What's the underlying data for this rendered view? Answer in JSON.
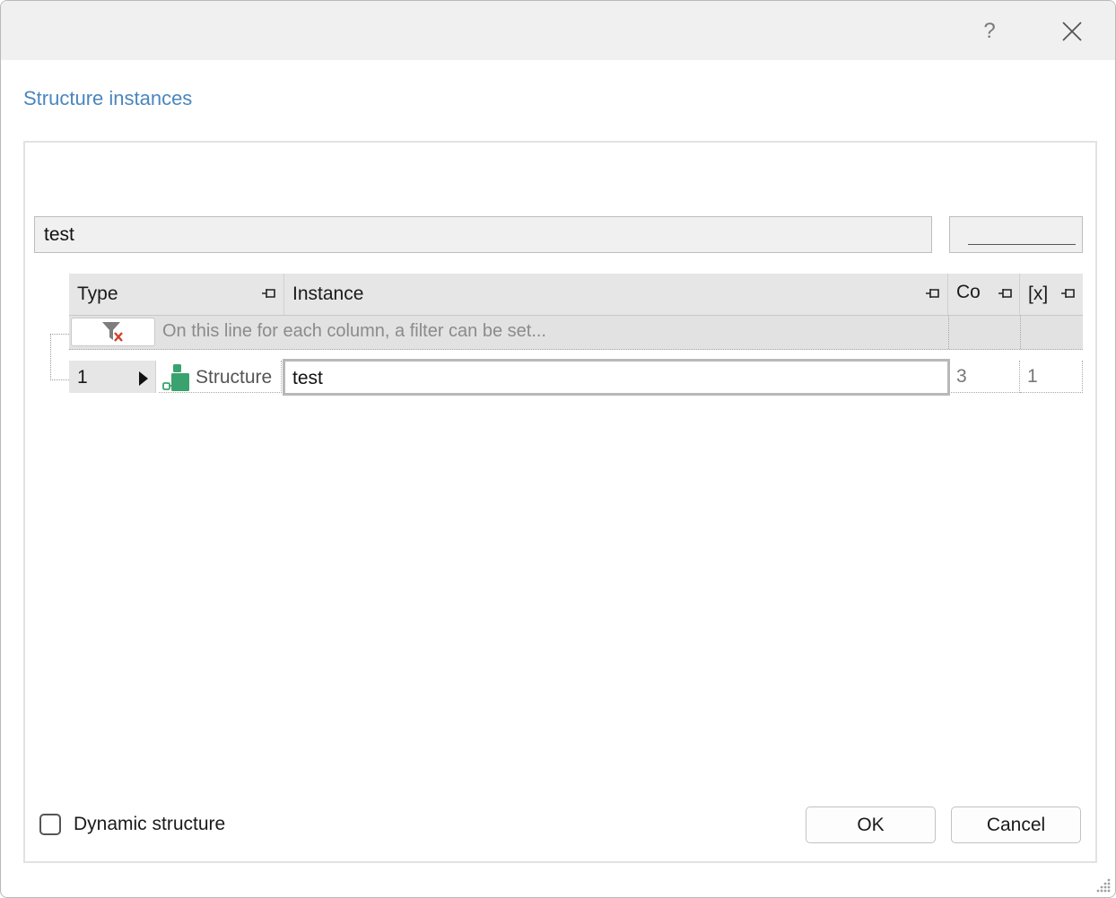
{
  "titlebar": {
    "help_label": "?"
  },
  "header": {
    "subtitle": "Structure instances"
  },
  "search": {
    "value": "test",
    "placeholder": ""
  },
  "grid": {
    "columns": [
      {
        "label": "Type"
      },
      {
        "label": "Instance"
      },
      {
        "label": "Co"
      },
      {
        "label": "[x]"
      }
    ],
    "filter_hint": "On this line for each column, a filter can be set...",
    "rows": [
      {
        "index": "1",
        "type": "Structure",
        "instance": "test",
        "co": "3",
        "x": "1"
      }
    ]
  },
  "footer": {
    "checkbox_label": "Dynamic structure",
    "ok_label": "OK",
    "cancel_label": "Cancel"
  },
  "icons": {
    "close": "close-icon",
    "pin": "pin-icon",
    "filter_clear": "filter-clear-icon",
    "structure": "structure-icon",
    "row_arrow": "row-pointer-icon",
    "grip": "resize-grip-icon"
  },
  "colors": {
    "accent": "#4a86bf",
    "structure_icon": "#3aa26e",
    "clear_x": "#d0402c"
  }
}
